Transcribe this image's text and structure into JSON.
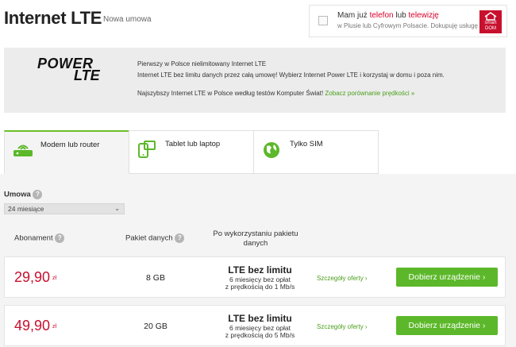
{
  "header": {
    "title": "Internet LTE",
    "subtitle": "Nowa umowa"
  },
  "promo": {
    "line1_pre": "Mam już ",
    "line1_hl1": "telefon",
    "line1_mid": " lub ",
    "line1_hl2": "telewizję",
    "line2": "w Plusie lub Cyfrowym Polsacie. Dokupuję usługę",
    "logo_top": "smart",
    "logo_bottom": "DOM"
  },
  "banner": {
    "logo_line1": "POWER",
    "logo_line2": "LTE",
    "line1": "Pierwszy w Polsce nielimitowany Internet LTE",
    "line2": "Internet LTE bez limitu danych przez całą umowę! Wybierz Internet Power LTE i korzystaj w domu i poza nim.",
    "line3": "Najszybszy Internet LTE w Polsce według testów Komputer Świat!",
    "link": "Zobacz porównanie prędkości »"
  },
  "tabs": [
    {
      "label": "Modem lub router",
      "icon": "router-icon"
    },
    {
      "label": "Tablet lub laptop",
      "icon": "tablet-laptop-icon"
    },
    {
      "label": "Tylko SIM",
      "icon": "globe-icon"
    }
  ],
  "filters": {
    "umowa_label": "Umowa",
    "umowa_value": "24 miesiące"
  },
  "columns": {
    "abonament": "Abonament",
    "pakiet": "Pakiet danych",
    "po_wykorzystaniu_1": "Po wykorzystaniu pakietu",
    "po_wykorzystaniu_2": "danych"
  },
  "offers": [
    {
      "price": "29,90",
      "currency": "zł",
      "data": "8 GB",
      "lte_title": "LTE bez limitu",
      "lte_sub1": "6 miesięcy bez opłat",
      "lte_sub2": "z prędkością do 1 Mb/s",
      "details": "Szczegóły oferty ›",
      "cta": "Dobierz urządzenie ›"
    },
    {
      "price": "49,90",
      "currency": "zł",
      "data": "20 GB",
      "lte_title": "LTE bez limitu",
      "lte_sub1": "6 miesięcy bez opłat",
      "lte_sub2": "z prędkością do 5 Mb/s",
      "details": "Szczegóły oferty ›",
      "cta": "Dobierz urządzenie ›"
    }
  ],
  "colors": {
    "accent_red": "#c8102e",
    "accent_green": "#5cb82a",
    "link_green": "#4a9e1a"
  }
}
